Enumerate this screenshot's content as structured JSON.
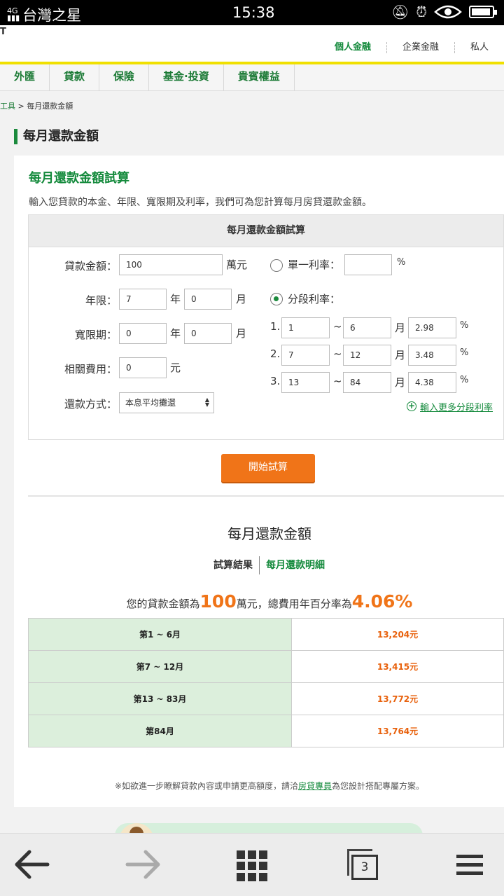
{
  "statusbar": {
    "signal": "4G",
    "carrier": "台灣之星",
    "time": "15:38",
    "battery_level": 0.8
  },
  "header": {
    "logo_fragment": "T",
    "tabs": [
      "個人金融",
      "企業金融",
      "私人"
    ],
    "active_tab": "個人金融"
  },
  "categories": [
    "外匯",
    "貸款",
    "保險",
    "基金·投資",
    "貴賓權益"
  ],
  "breadcrumb": {
    "link": "工具",
    "separator": ">",
    "current": "每月還款金額"
  },
  "page_title": "每月還款金額",
  "calculator": {
    "heading": "每月還款金額試算",
    "description": "輸入您貸款的本金、年限、寬限期及利率，我們可為您計算每月房貸還款金額。",
    "box_title": "每月還款金額試算",
    "loan_amount": {
      "label": "貸款金額：",
      "value": "100",
      "unit": "萬元"
    },
    "term": {
      "label": "年限：",
      "years": "7",
      "year_unit": "年",
      "months": "0",
      "month_unit": "月"
    },
    "grace": {
      "label": "寬限期：",
      "years": "0",
      "year_unit": "年",
      "months": "0",
      "month_unit": "月"
    },
    "fees": {
      "label": "相關費用：",
      "value": "0",
      "unit": "元"
    },
    "repayment": {
      "label": "還款方式：",
      "selected": "本息平均攤還"
    },
    "single_rate": {
      "label": "單一利率：",
      "value": "",
      "unit": "%"
    },
    "tiered_rate": {
      "label": "分段利率：",
      "tilde": "~",
      "month_unit": "月",
      "pct_unit": "%",
      "rows": [
        {
          "num": "1.",
          "from": "1",
          "to": "6",
          "rate": "2.98"
        },
        {
          "num": "2.",
          "from": "7",
          "to": "12",
          "rate": "3.48"
        },
        {
          "num": "3.",
          "from": "13",
          "to": "84",
          "rate": "4.38"
        }
      ]
    },
    "more_link": "輸入更多分段利率",
    "start_button": "開始試算"
  },
  "result": {
    "title": "每月還款金額",
    "tab_summary": "試算結果",
    "tab_detail": "每月還款明細",
    "summary_pre": "您的貸款金額為",
    "summary_amount": "100",
    "summary_mid": "萬元，總費用年百分率為",
    "summary_rate": "4.06%",
    "rows": [
      {
        "period": "第1 ~ 6月",
        "amount": "13,204元"
      },
      {
        "period": "第7 ~ 12月",
        "amount": "13,415元"
      },
      {
        "period": "第13 ~ 83月",
        "amount": "13,772元"
      },
      {
        "period": "第84月",
        "amount": "13,764元"
      }
    ],
    "note_pre": "※如欲進一步瞭解貸款內容或申請更高額度，請洽",
    "note_link": "房貸專員",
    "note_post": "為您設計搭配專屬方案。"
  },
  "bottombar": {
    "tab_count": "3"
  }
}
